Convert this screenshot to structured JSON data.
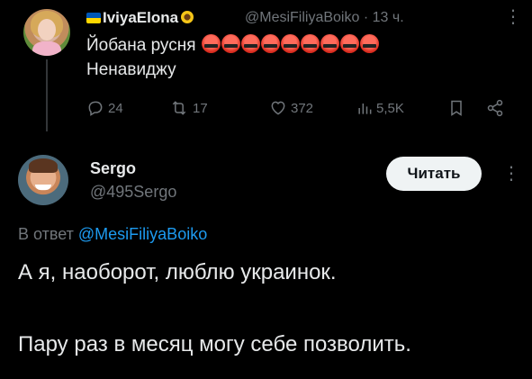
{
  "parent_tweet": {
    "display_name": "IviyaElona",
    "handle": "@MesiFiliyaBoiko",
    "separator": "·",
    "time": "13 ч.",
    "line1": "Йобана русня",
    "line2": "Ненавиджу",
    "emoji_count": 9,
    "emoji_icon": "angry-face-icon",
    "badges": [
      "ukraine-flag-icon",
      "sunflower-icon"
    ],
    "actions": {
      "replies": "24",
      "reposts": "17",
      "likes": "372",
      "views": "5,5K"
    }
  },
  "tweet": {
    "display_name": "Sergo",
    "handle": "@495Sergo",
    "follow_label": "Читать",
    "reply_prefix": "В ответ",
    "reply_mention": "@MesiFiliyaBoiko",
    "text_line1": "А я, наоборот, люблю украинок.",
    "text_line2": "Пару раз в месяц могу себе позволить."
  },
  "colors": {
    "background": "#000000",
    "text": "#e7e9ea",
    "secondary": "#71767b",
    "link": "#1d9bf0",
    "button_bg": "#eff3f4"
  }
}
